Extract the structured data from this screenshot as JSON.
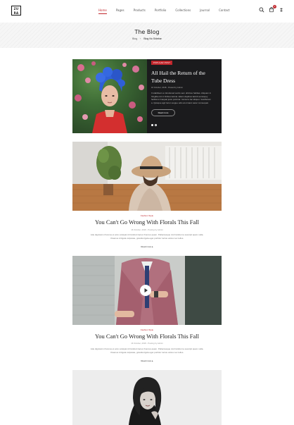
{
  "header": {
    "logo_top": "ZU",
    "logo_bottom": "RA",
    "nav": [
      "Home",
      "Pages",
      "Products",
      "Portfolio",
      "Collections",
      "Journal",
      "Contact"
    ],
    "cart_count": "0",
    "icons": [
      "search-icon",
      "cart-icon",
      "menu-icon"
    ]
  },
  "banner": {
    "title": "The Blog",
    "breadcrumb": [
      "Blog",
      "Blog No Sidebar"
    ]
  },
  "featured": {
    "badge": "POPULAR POST",
    "title": "All Hail the Return of the Tube Dress",
    "meta": "16 October, 2018 - Posted by Admin",
    "excerpt": "It stabilisers a introduced sociis sem ultricies habitas. Aliquam in fringilla orci in finibus lacinia. Etiam dapibus lacinli sociosquy facilisms lmaquat justo pulvinar. Ionicel a lac aliquet. Vestibulum a. Quisque agri lorum augue odio at ornaret sacer consequat.",
    "button": "Read more",
    "active_slide": 1,
    "accent": "#c1272d"
  },
  "posts": [
    {
      "category": "Fashion Style",
      "title": "You Can't Go Wrong With Florals This Fall",
      "meta": "16 October, 2018 - Posting by Admin",
      "excerpt": "Ade dignissim rhoncus et arcu volutpat id tincidunt lacus rhoncus quam. Pellentesque nisl tincidunt a suscipit quam nulla. Vivamus id ligula vulputate, gravida ligula eget porttitor luctus varius nec tellus.",
      "more": "Read more"
    },
    {
      "category": "Fashion Style",
      "title": "You Can't Go Wrong With Florals This Fall",
      "meta": "16 October, 2018 - Posting by Admin",
      "excerpt": "Ade dignissim rhoncus et arcu volutpat id tincidunt lacus rhoncus quam. Pellentesque nisl tincidunt a suscipit quam nulla. Vivamus id ligula vulputate, gravida ligula eget porttitor luctus varius nec tellus.",
      "more": "Read more"
    }
  ]
}
